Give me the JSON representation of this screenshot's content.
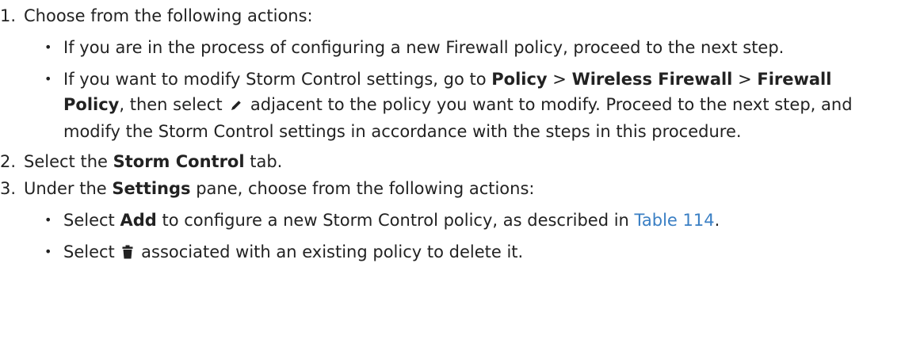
{
  "steps": [
    {
      "number": "1.",
      "text": "Choose from the following actions:",
      "items": [
        {
          "text": "If you are in the process of configuring a new Firewall policy, proceed to the next step."
        },
        {
          "pre": "If you want to modify Storm Control settings, go to ",
          "bold1": "Policy",
          "sep1": " > ",
          "bold2": "Wireless Firewall",
          "sep2": " > ",
          "bold3": "Firewall Policy",
          "mid": ", then select ",
          "icon": "edit-pencil-icon",
          "post": " adjacent to the policy you want to modify. Proceed to the next step, and modify the Storm Control settings in accordance with the steps in this procedure."
        }
      ]
    },
    {
      "number": "2.",
      "pre": "Select the ",
      "bold": "Storm Control",
      "post": " tab."
    },
    {
      "number": "3.",
      "pre": "Under the ",
      "bold": "Settings",
      "post": " pane, choose from the following actions:",
      "items": [
        {
          "pre": "Select ",
          "bold": "Add",
          "mid": " to configure a new Storm Control policy, as described in ",
          "link": "Table 114",
          "post": "."
        },
        {
          "pre": "Select ",
          "icon": "trash-icon",
          "post": " associated with an existing policy to delete it."
        }
      ]
    }
  ],
  "colors": {
    "text": "#222222",
    "link": "#3a7fc4"
  }
}
